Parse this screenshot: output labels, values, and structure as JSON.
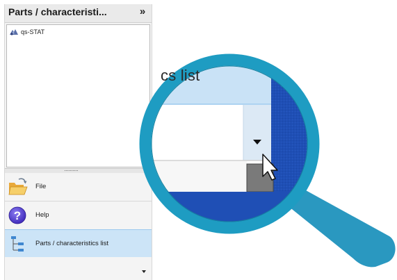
{
  "panel": {
    "title": "Parts / characteristi...",
    "collapse_glyph": "»",
    "collapse_icon": "double-chevron-right-icon"
  },
  "tree": {
    "items": [
      {
        "label": "qs-STAT",
        "icon": "qs-stat-logo-icon"
      }
    ]
  },
  "splitter": {
    "grip": "··········"
  },
  "nav": {
    "items": [
      {
        "label": "File",
        "icon": "folder-open-icon"
      },
      {
        "label": "Help",
        "icon": "help-question-icon"
      },
      {
        "label": "Parts / characteristics list",
        "icon": "tree-hierarchy-icon",
        "selected": true
      }
    ],
    "dropdown_icon": "chevron-down-icon"
  },
  "magnifier": {
    "zoomed_text": "cs list",
    "icon": "magnifying-glass-icon",
    "colors": {
      "ring": "#1e9cc2",
      "handle": "#2a98c0",
      "zoom_bg": "#1f4fb5",
      "zoom_header": "#c9e2f6",
      "zoom_field": "#dce9f5"
    }
  }
}
